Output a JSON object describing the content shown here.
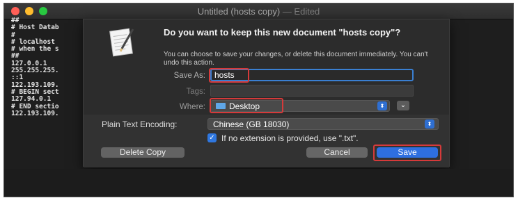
{
  "window": {
    "title": "Untitled (hosts copy)",
    "edited_suffix": " — Edited"
  },
  "editor": {
    "lines": [
      "##",
      "# Host Datab",
      "#",
      "# localhost",
      "# when the s",
      "##",
      "127.0.0.1",
      "255.255.255.",
      "::1",
      "122.193.109.",
      "# BEGIN sect",
      "127.94.0.1",
      "# END sectio",
      "122.193.109."
    ]
  },
  "dialog": {
    "heading": "Do you want to keep this new document \"hosts copy\"?",
    "message": "You can choose to save your changes, or delete this document immediately. You can't undo this action.",
    "save_as_label": "Save As:",
    "save_as_value": "hosts",
    "tags_label": "Tags:",
    "where_label": "Where:",
    "where_value": "Desktop",
    "encoding_label": "Plain Text Encoding:",
    "encoding_value": "Chinese (GB 18030)",
    "checkbox_label": "If no extension is provided, use \".txt\".",
    "checkbox_checked": true,
    "delete_label": "Delete Copy",
    "cancel_label": "Cancel",
    "save_label": "Save"
  },
  "icons": {
    "document": "document-icon",
    "folder": "folder-icon",
    "stepper": "stepper-icon",
    "expand": "chevron-down-icon",
    "check": "check-icon"
  },
  "colors": {
    "accent": "#2e6fe0",
    "highlight": "#d63a3a"
  }
}
